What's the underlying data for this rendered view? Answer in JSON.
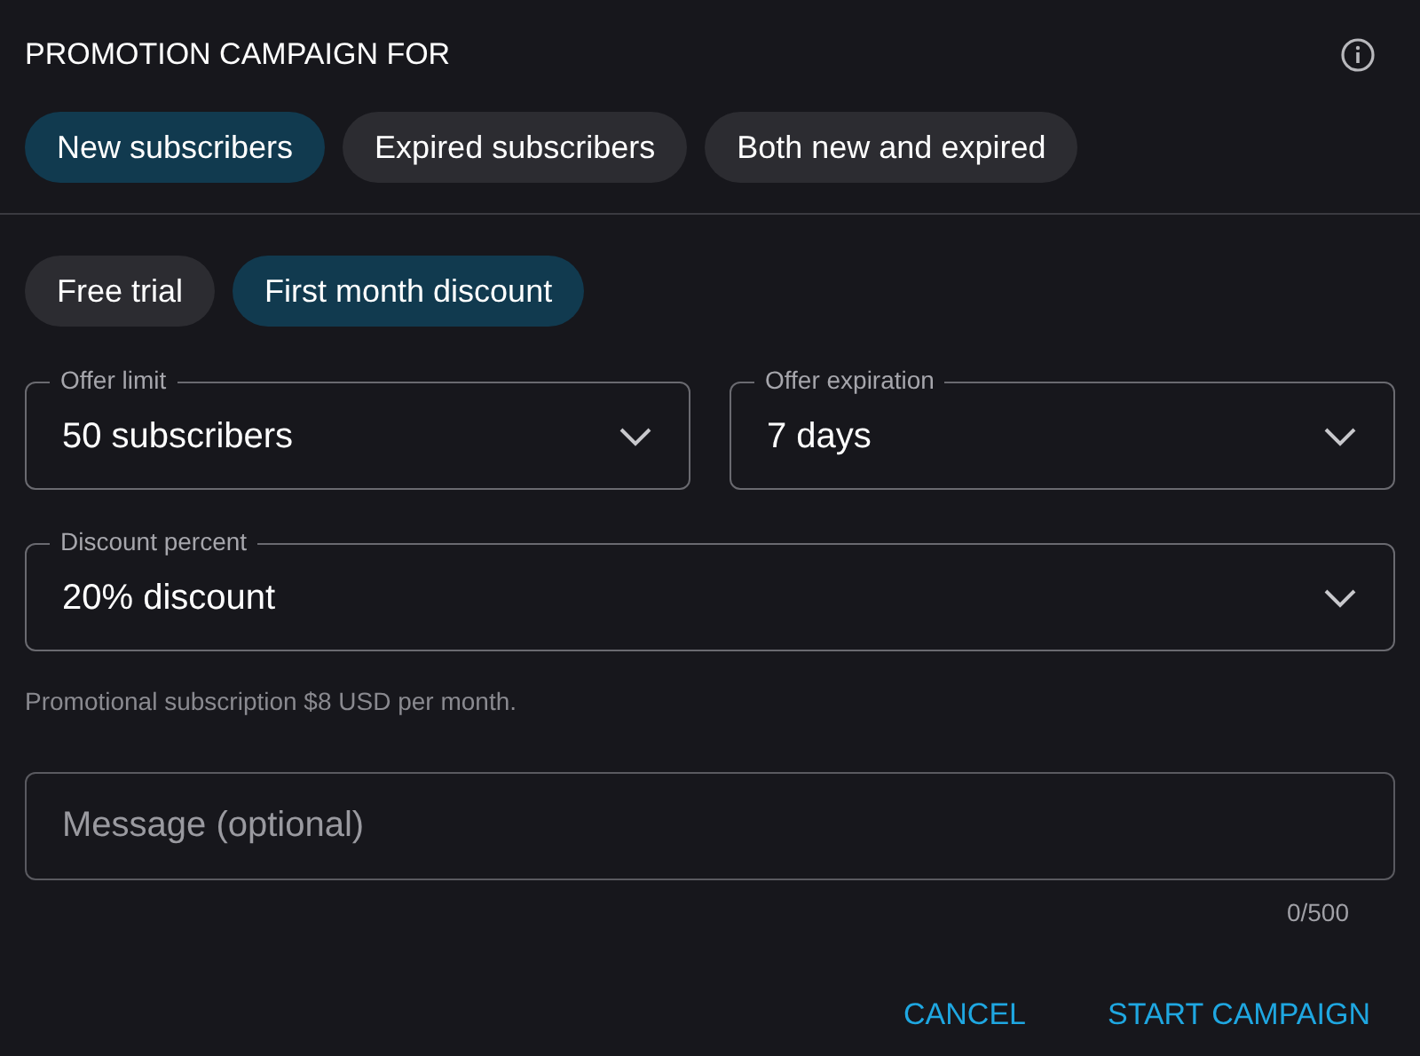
{
  "title": "PROMOTION CAMPAIGN FOR",
  "audience": [
    {
      "label": "New subscribers",
      "selected": true
    },
    {
      "label": "Expired subscribers",
      "selected": false
    },
    {
      "label": "Both new and expired",
      "selected": false
    }
  ],
  "offer_type": [
    {
      "label": "Free trial",
      "selected": false
    },
    {
      "label": "First month discount",
      "selected": true
    }
  ],
  "offer_limit": {
    "label": "Offer limit",
    "value": "50 subscribers"
  },
  "offer_expiration": {
    "label": "Offer expiration",
    "value": "7 days"
  },
  "discount_percent": {
    "label": "Discount percent",
    "value": "20% discount"
  },
  "hint": "Promotional subscription $8 USD per month.",
  "message": {
    "placeholder": "Message (optional)",
    "counter": "0/500"
  },
  "buttons": [
    "CANCEL",
    "START CAMPAIGN"
  ]
}
